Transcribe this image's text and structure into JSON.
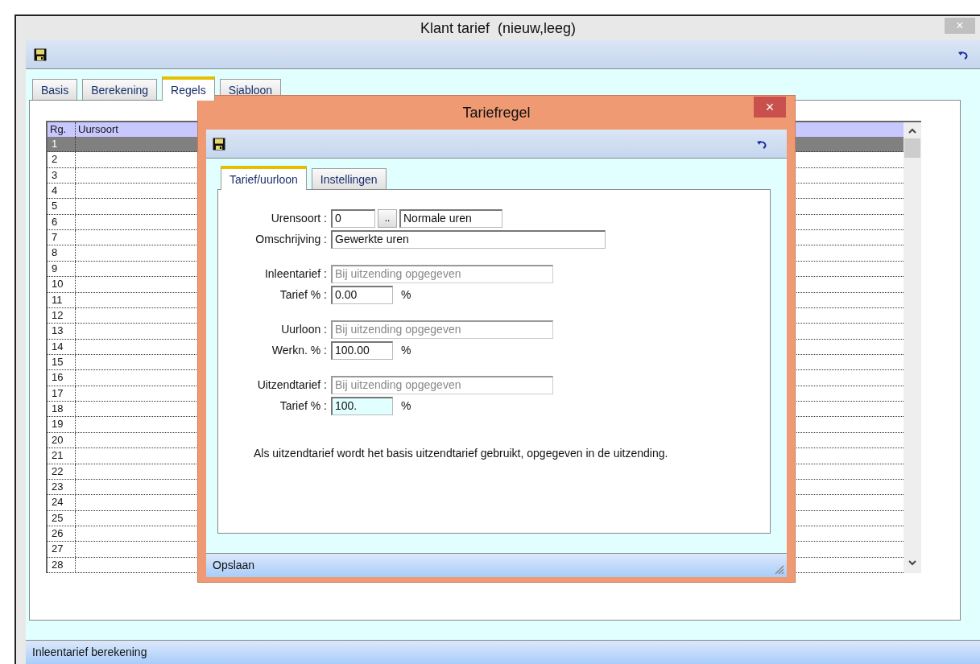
{
  "window": {
    "title": "Klant tarief  (nieuw,leeg)",
    "close": "×"
  },
  "tabs": [
    {
      "label": "Basis",
      "selected": false
    },
    {
      "label": "Berekening",
      "selected": false
    },
    {
      "label": "Regels",
      "selected": true
    },
    {
      "label": "Sjabloon",
      "selected": false
    }
  ],
  "grid": {
    "columns": [
      "Rg.",
      "Uursoort"
    ],
    "rows": [
      {
        "number": "1",
        "selected": true
      },
      {
        "number": "2",
        "selected": false
      },
      {
        "number": "3",
        "selected": false
      },
      {
        "number": "4",
        "selected": false
      },
      {
        "number": "5",
        "selected": false
      },
      {
        "number": "6",
        "selected": false
      },
      {
        "number": "7",
        "selected": false
      },
      {
        "number": "8",
        "selected": false
      },
      {
        "number": "9",
        "selected": false
      },
      {
        "number": "10",
        "selected": false
      },
      {
        "number": "11",
        "selected": false
      },
      {
        "number": "12",
        "selected": false
      },
      {
        "number": "13",
        "selected": false
      },
      {
        "number": "14",
        "selected": false
      },
      {
        "number": "15",
        "selected": false
      },
      {
        "number": "16",
        "selected": false
      },
      {
        "number": "17",
        "selected": false
      },
      {
        "number": "18",
        "selected": false
      },
      {
        "number": "19",
        "selected": false
      },
      {
        "number": "20",
        "selected": false
      },
      {
        "number": "21",
        "selected": false
      },
      {
        "number": "22",
        "selected": false
      },
      {
        "number": "23",
        "selected": false
      },
      {
        "number": "24",
        "selected": false
      },
      {
        "number": "25",
        "selected": false
      },
      {
        "number": "26",
        "selected": false
      },
      {
        "number": "27",
        "selected": false
      },
      {
        "number": "28",
        "selected": false
      }
    ]
  },
  "status_bar": "Inleentarief berekening",
  "dialog": {
    "title": "Tariefregel",
    "close": "×",
    "tabs": [
      {
        "label": "Tarief/uurloon",
        "selected": true
      },
      {
        "label": "Instellingen",
        "selected": false
      }
    ],
    "groups": [
      [
        {
          "label": "Urensoort :",
          "kind": "lookup",
          "value": "0",
          "button": "..",
          "name": "Normale uren"
        },
        {
          "label": "Omschrijving :",
          "kind": "text",
          "value": "Gewerkte uren",
          "disabled": false
        }
      ],
      [
        {
          "label": "Inleentarief :",
          "kind": "text",
          "value": "Bij uitzending opgegeven",
          "disabled": true
        },
        {
          "label": "Tarief % :",
          "kind": "percent",
          "value": "0.00",
          "unit": "%",
          "focused": false
        }
      ],
      [
        {
          "label": "Uurloon :",
          "kind": "text",
          "value": "Bij uitzending opgegeven",
          "disabled": true
        },
        {
          "label": "Werkn. % :",
          "kind": "percent",
          "value": "100.00",
          "unit": "%",
          "focused": false
        }
      ],
      [
        {
          "label": "Uitzendtarief :",
          "kind": "text",
          "value": "Bij uitzending opgegeven",
          "disabled": true
        },
        {
          "label": "Tarief % :",
          "kind": "percent",
          "value": "100.",
          "unit": "%",
          "focused": true
        }
      ]
    ],
    "note": "Als uitzendtarief wordt het basis uitzendtarief gebruikt, opgegeven in de uitzending.",
    "status_bar": "Opslaan"
  }
}
